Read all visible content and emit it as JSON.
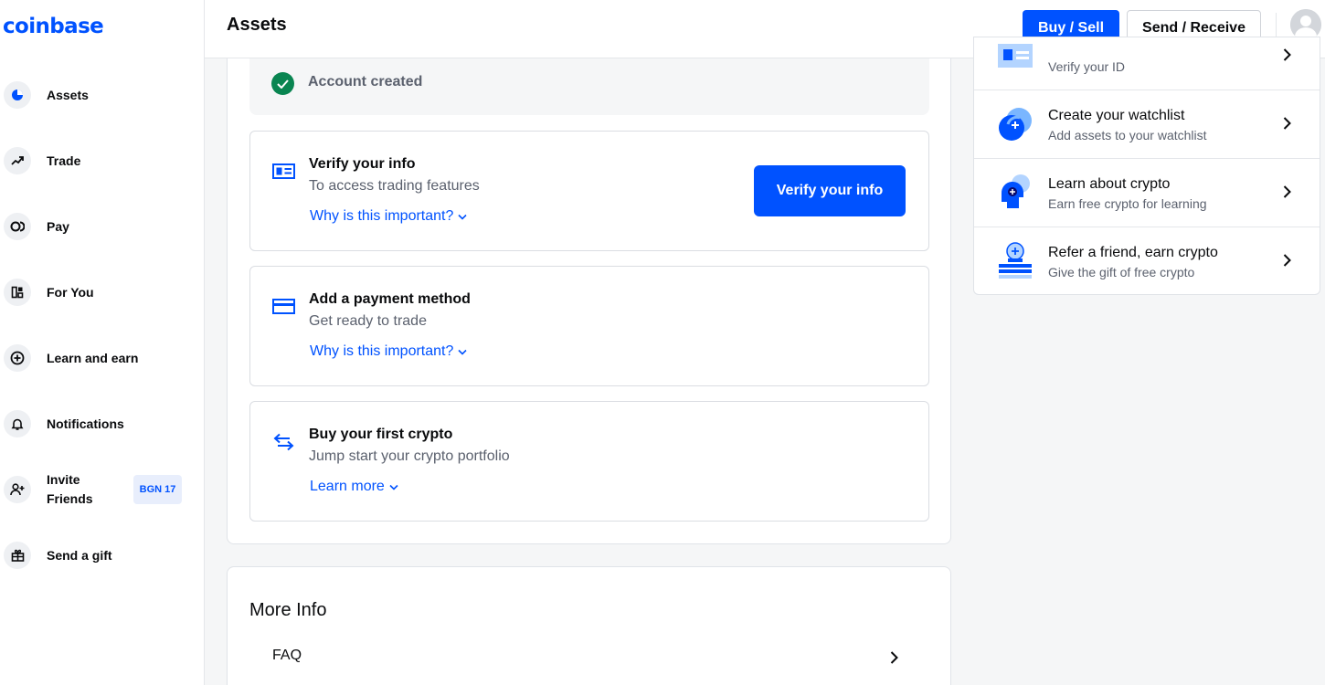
{
  "brand": {
    "logo": "coinbase",
    "accent": "#0052ff"
  },
  "sidebar": {
    "items": [
      {
        "label": "Assets",
        "icon": "pie-chart-icon"
      },
      {
        "label": "Trade",
        "icon": "trend-icon"
      },
      {
        "label": "Pay",
        "icon": "pay-icon"
      },
      {
        "label": "For You",
        "icon": "for-you-icon"
      },
      {
        "label": "Learn and earn",
        "icon": "plus-circle-icon"
      },
      {
        "label": "Notifications",
        "icon": "bell-icon"
      },
      {
        "label": "Invite\nFriends",
        "icon": "invite-icon",
        "badge": "BGN 17"
      },
      {
        "label": "Send a gift",
        "icon": "gift-icon"
      }
    ]
  },
  "header": {
    "title": "Assets",
    "buy_sell": "Buy / Sell",
    "send_receive": "Send / Receive"
  },
  "main": {
    "account_created": "Account created",
    "steps": [
      {
        "title": "Verify your info",
        "subtitle": "To access trading features",
        "link": "Why is this important?",
        "button": "Verify your info",
        "icon": "id-card-icon"
      },
      {
        "title": "Add a payment method",
        "subtitle": "Get ready to trade",
        "link": "Why is this important?",
        "icon": "card-icon"
      },
      {
        "title": "Buy your first crypto",
        "subtitle": "Jump start your crypto portfolio",
        "link": "Learn more",
        "icon": "swap-icon"
      }
    ],
    "more_info": {
      "title": "More Info",
      "faq": "FAQ"
    }
  },
  "right_panel": {
    "items": [
      {
        "title": "",
        "subtitle": "Verify your ID",
        "icon": "verify-id-icon"
      },
      {
        "title": "Create your watchlist",
        "subtitle": "Add assets to your watchlist",
        "icon": "watchlist-icon"
      },
      {
        "title": "Learn about crypto",
        "subtitle": "Earn free crypto for learning",
        "icon": "learn-crypto-icon"
      },
      {
        "title": "Refer a friend, earn crypto",
        "subtitle": "Give the gift of free crypto",
        "icon": "refer-icon"
      }
    ]
  }
}
